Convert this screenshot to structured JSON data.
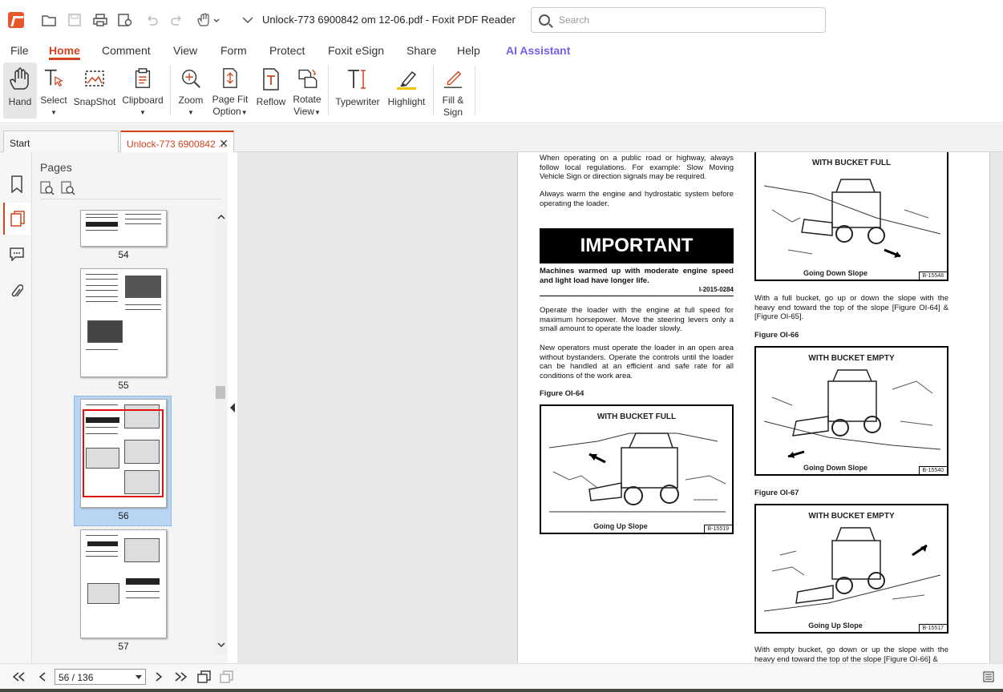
{
  "window": {
    "title": "Unlock-773 6900842  om 12-06.pdf - Foxit PDF Reader",
    "search_placeholder": "Search"
  },
  "menu": [
    "File",
    "Home",
    "Comment",
    "View",
    "Form",
    "Protect",
    "Foxit eSign",
    "Share",
    "Help",
    "AI Assistant"
  ],
  "ribbon": {
    "hand": "Hand",
    "select": "Select",
    "snapshot": "SnapShot",
    "clipboard": "Clipboard",
    "zoom": "Zoom",
    "page_fit_1": "Page Fit",
    "page_fit_2": "Option",
    "reflow": "Reflow",
    "rotate_1": "Rotate",
    "rotate_2": "View",
    "typewriter": "Typewriter",
    "highlight": "Highlight",
    "fill_1": "Fill &",
    "fill_2": "Sign"
  },
  "tabs": {
    "start": "Start",
    "doc": "Unlock-773 6900842 ..."
  },
  "pages_panel": {
    "title": "Pages",
    "thumbnails": [
      "54",
      "55",
      "56",
      "57"
    ],
    "selected": "56"
  },
  "document": {
    "left_p1": "When operating on a public road or highway, always follow local regulations. For example: Slow Moving Vehicle Sign or direction signals may be required.",
    "left_p2": "Always warm the engine and hydrostatic system before operating the loader.",
    "important_heading": "IMPORTANT",
    "important_text": "Machines warmed up with moderate engine speed and light load have longer life.",
    "important_code": "I-2015-0284",
    "left_p3": "Operate the loader with the engine at full speed for maximum horsepower. Move the steering levers only a small amount to operate the loader slowly.",
    "left_p4": "New operators must operate the loader in an open area without bystanders. Operate the controls until the loader can be handled at an efficient and safe rate for all conditions of the work area.",
    "fig64_label": "Figure OI-64",
    "fig64_title": "WITH BUCKET FULL",
    "fig64_caption": "Going Up Slope",
    "fig64_code": "B-15519",
    "fig65_title": "WITH BUCKET FULL",
    "fig65_caption": "Going Down Slope",
    "fig65_code": "B-15548",
    "right_p1": "With a full bucket, go up or down the slope with the heavy end toward the top of the slope [Figure OI-64] & [Figure OI-65].",
    "fig66_label": "Figure OI-66",
    "fig66_title": "WITH BUCKET EMPTY",
    "fig66_caption": "Going Down Slope",
    "fig66_code": "B-15540",
    "fig67_label": "Figure OI-67",
    "fig67_title": "WITH BUCKET EMPTY",
    "fig67_caption": "Going Up Slope",
    "fig67_code": "B-15517",
    "right_p2": "With empty bucket, go down or up the slope with the heavy end toward the top of the slope [Figure OI-66] &"
  },
  "status": {
    "page_value": "56 / 136"
  },
  "colors": {
    "accent": "#d1441e",
    "ai": "#7a5cf0",
    "selection": "#b8d6f4"
  }
}
